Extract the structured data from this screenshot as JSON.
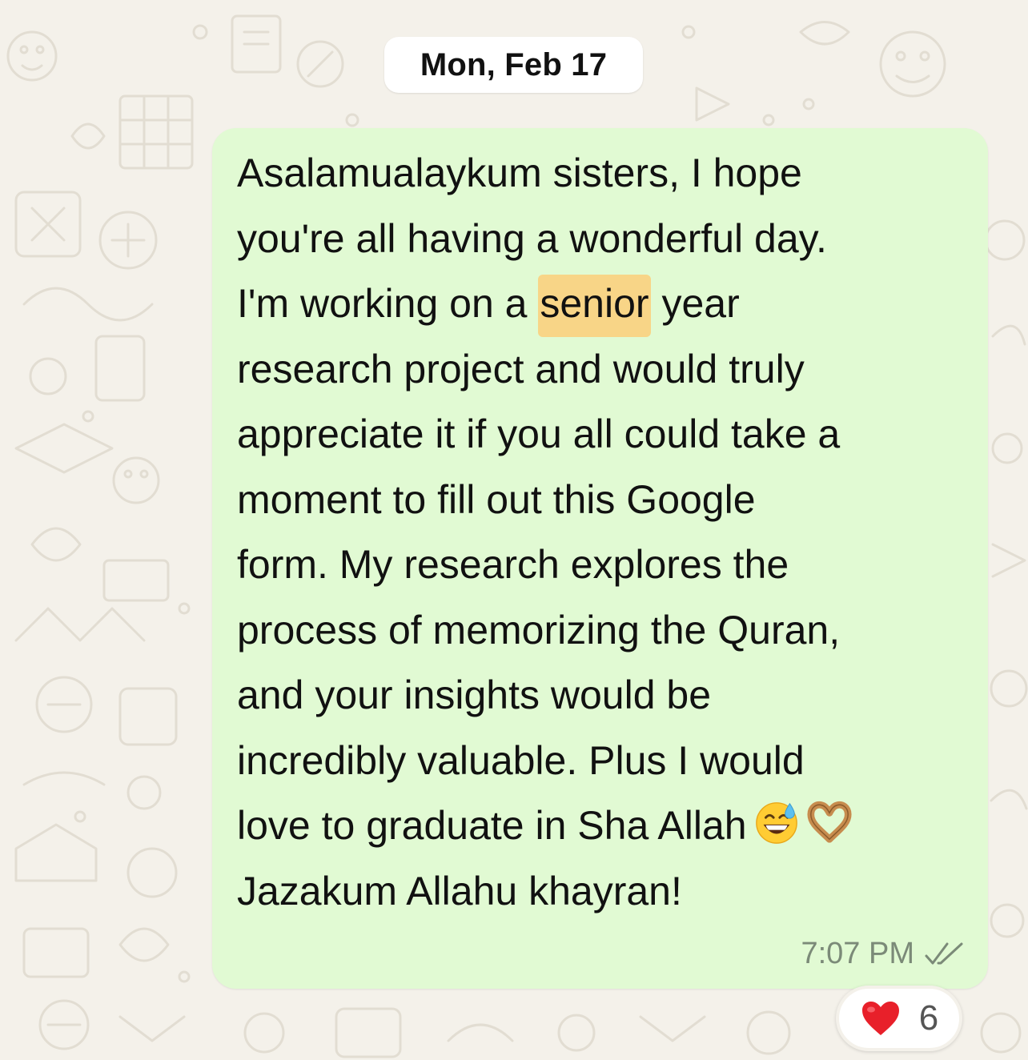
{
  "chat": {
    "date_separator": "Mon, Feb 17",
    "message": {
      "lines": [
        "Asalamualaykum sisters, I hope",
        "you're all having a wonderful day.",
        "I'm working on a ",
        "senior",
        " year",
        "research project and would truly",
        "appreciate it if you all could take a",
        "moment to fill out this Google",
        "form. My research explores the",
        "process of memorizing the Quran,",
        "and your insights would be",
        "incredibly valuable. Plus I would",
        "love to graduate in Sha Allah",
        "Jazakum Allahu khayran!"
      ],
      "highlighted_word": "senior",
      "emojis": [
        "grinning-sweat-emoji",
        "heart-hands-emoji"
      ],
      "time": "7:07 PM",
      "status_icon": "double-check-icon"
    },
    "reaction": {
      "emoji": "red-heart-emoji",
      "count": "6"
    },
    "colors": {
      "bubble": "#e1fad3",
      "highlight": "#f8d587",
      "wallpaper": "#f4f1ea"
    }
  }
}
